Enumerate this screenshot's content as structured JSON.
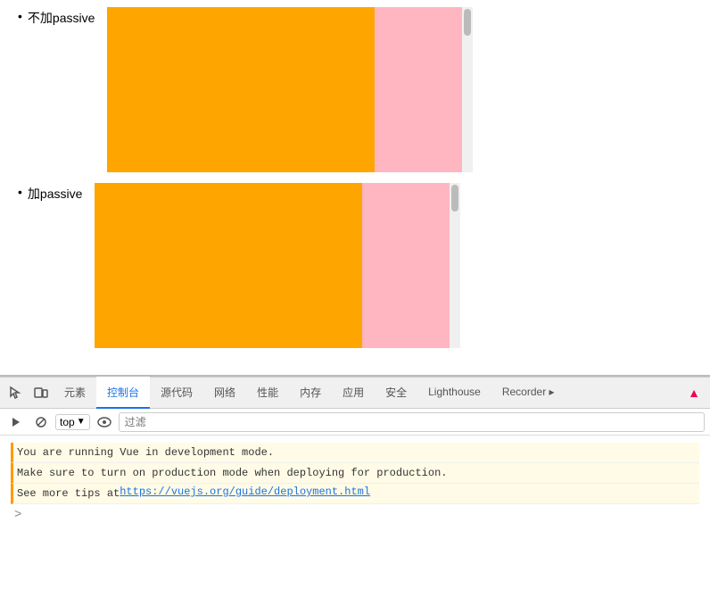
{
  "items": [
    {
      "label": "不加passive"
    },
    {
      "label": "加passive"
    }
  ],
  "tabs": [
    {
      "id": "elements",
      "label": "元素"
    },
    {
      "id": "console",
      "label": "控制台",
      "active": true
    },
    {
      "id": "source",
      "label": "源代码"
    },
    {
      "id": "network",
      "label": "网络"
    },
    {
      "id": "performance",
      "label": "性能"
    },
    {
      "id": "memory",
      "label": "内存"
    },
    {
      "id": "application",
      "label": "应用"
    },
    {
      "id": "security",
      "label": "安全"
    },
    {
      "id": "lighthouse",
      "label": "Lighthouse"
    },
    {
      "id": "recorder",
      "label": "Recorder ▸"
    }
  ],
  "console": {
    "filter_placeholder": "过滤",
    "top_label": "top",
    "line1": "You are running Vue in development mode.",
    "line2": "Make sure to turn on production mode when deploying for production.",
    "line3_prefix": "See more tips at ",
    "line3_link": "https://vuejs.org/guide/deployment.html",
    "prompt": ">"
  },
  "colors": {
    "orange": "#ffa500",
    "pink": "#ffb6c1",
    "active_tab": "#1a73e8"
  }
}
